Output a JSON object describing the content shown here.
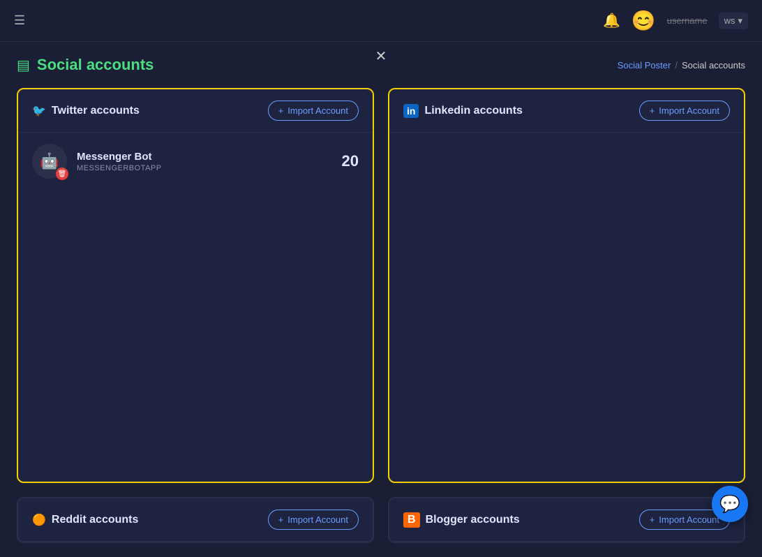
{
  "navbar": {
    "menu_icon": "☰",
    "bell_icon": "🔔",
    "avatar_emoji": "😊",
    "username": "username",
    "workspace": "ws",
    "dropdown_icon": "▾"
  },
  "close_button": "✕",
  "breadcrumb": {
    "parent": "Social Poster",
    "separator": "/",
    "current": "Social accounts"
  },
  "page": {
    "icon": "▤",
    "title": "Social accounts"
  },
  "cards": {
    "twitter": {
      "icon": "🐦",
      "title": "Twitter accounts",
      "import_plus": "+",
      "import_label": "Import Account",
      "account": {
        "name": "Messenger Bot",
        "username": "MESSENGERBOTAPP",
        "count": "20"
      }
    },
    "linkedin": {
      "icon": "in",
      "title": "Linkedin accounts",
      "import_plus": "+",
      "import_label": "Import Account"
    },
    "reddit": {
      "icon": "r/",
      "title": "Reddit accounts",
      "import_plus": "+",
      "import_label": "Import Account"
    },
    "blogger": {
      "icon": "B",
      "title": "Blogger accounts",
      "import_plus": "+",
      "import_label": "Import Account"
    }
  },
  "chat_bubble": "💬"
}
